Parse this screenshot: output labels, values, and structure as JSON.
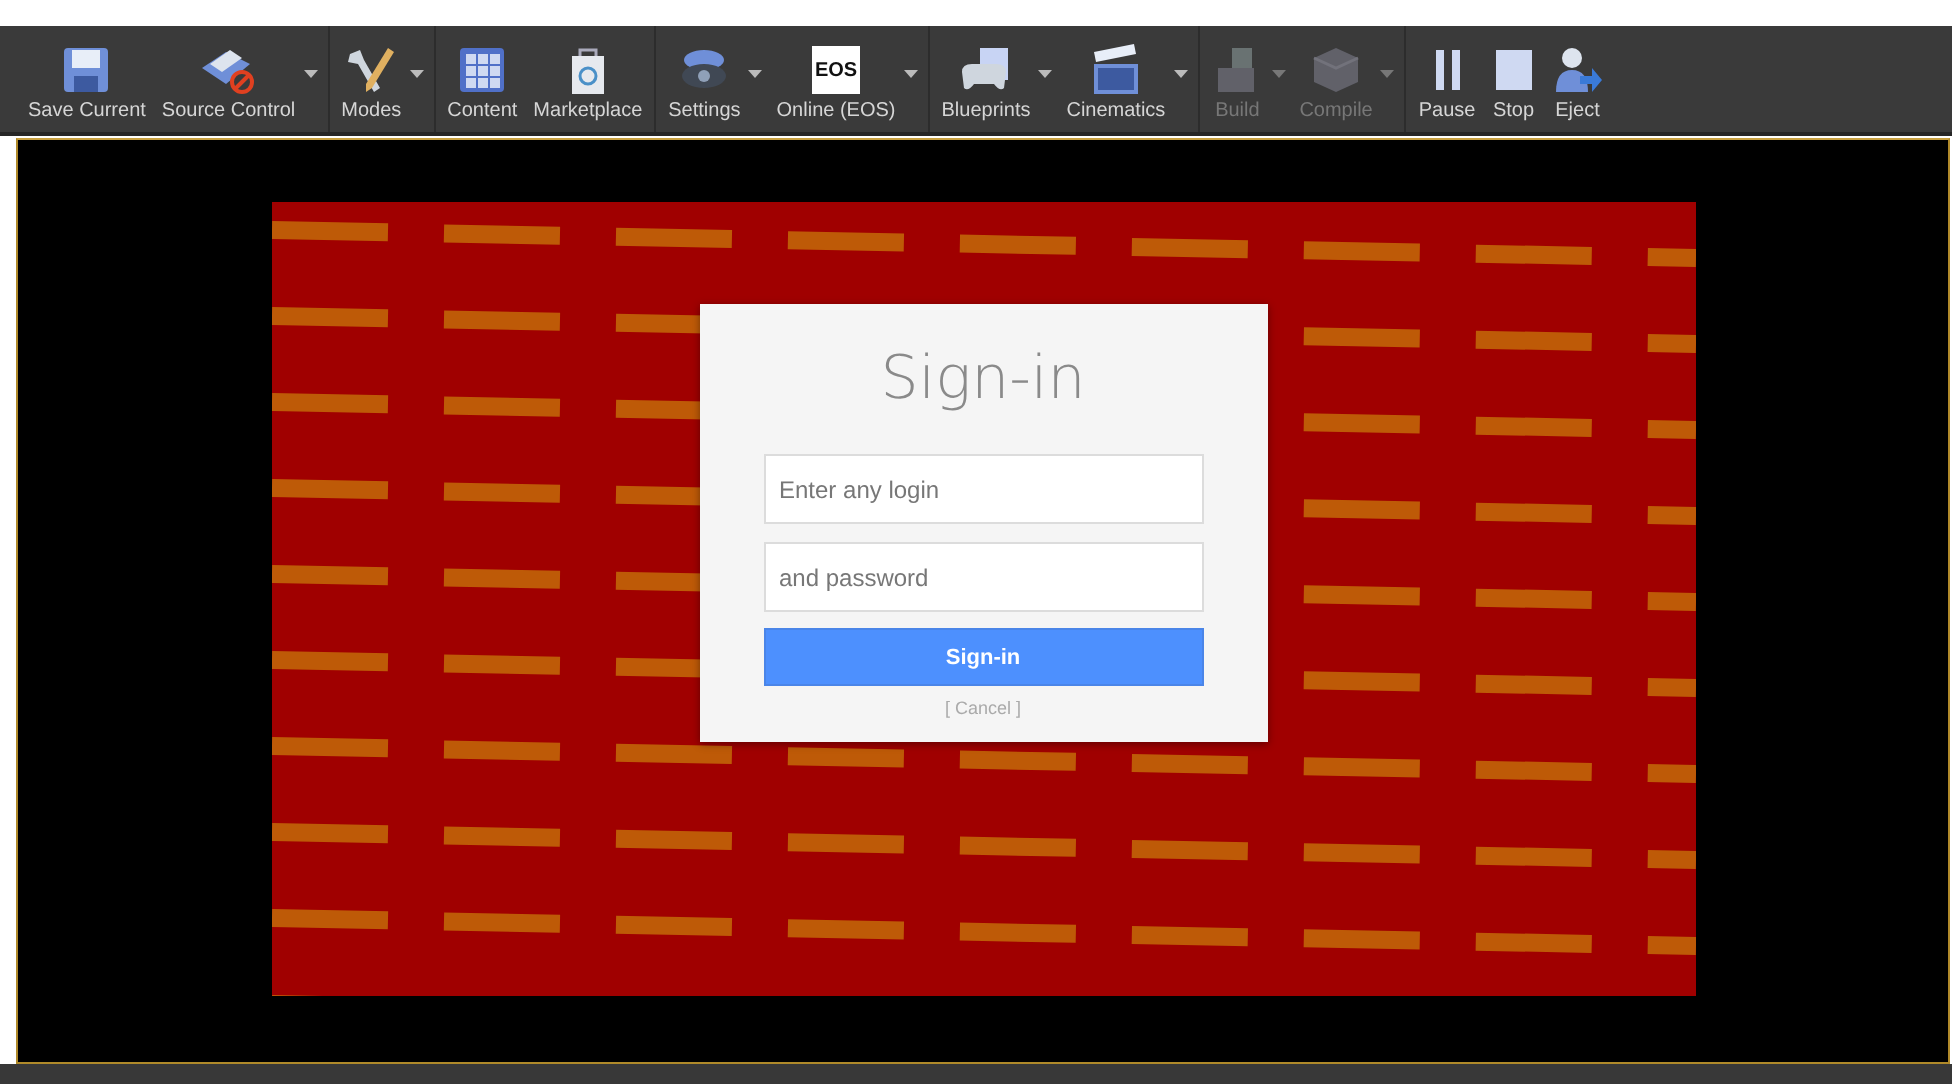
{
  "toolbar": {
    "groups": [
      {
        "items": [
          {
            "label": "Save Current",
            "dropdown": false,
            "disabled": false
          },
          {
            "label": "Source Control",
            "dropdown": true,
            "disabled": false
          }
        ]
      },
      {
        "items": [
          {
            "label": "Modes",
            "dropdown": true,
            "disabled": false
          }
        ]
      },
      {
        "items": [
          {
            "label": "Content",
            "dropdown": false,
            "disabled": false
          },
          {
            "label": "Marketplace",
            "dropdown": false,
            "disabled": false
          }
        ]
      },
      {
        "items": [
          {
            "label": "Settings",
            "dropdown": true,
            "disabled": false
          },
          {
            "label": "Online (EOS)",
            "dropdown": true,
            "disabled": false,
            "icon_text": "EOS"
          }
        ]
      },
      {
        "items": [
          {
            "label": "Blueprints",
            "dropdown": true,
            "disabled": false
          },
          {
            "label": "Cinematics",
            "dropdown": true,
            "disabled": false
          }
        ]
      },
      {
        "items": [
          {
            "label": "Build",
            "dropdown": true,
            "disabled": true
          },
          {
            "label": "Compile",
            "dropdown": true,
            "disabled": true
          }
        ]
      },
      {
        "items": [
          {
            "label": "Pause",
            "dropdown": false,
            "disabled": false
          },
          {
            "label": "Stop",
            "dropdown": false,
            "disabled": false
          },
          {
            "label": "Eject",
            "dropdown": false,
            "disabled": false
          }
        ]
      }
    ]
  },
  "viewport": {
    "dialog": {
      "title": "Sign-in",
      "login": {
        "placeholder": "Enter any login"
      },
      "password": {
        "placeholder": "and password"
      },
      "submit": "Sign-in",
      "cancel": "[ Cancel ]"
    }
  }
}
